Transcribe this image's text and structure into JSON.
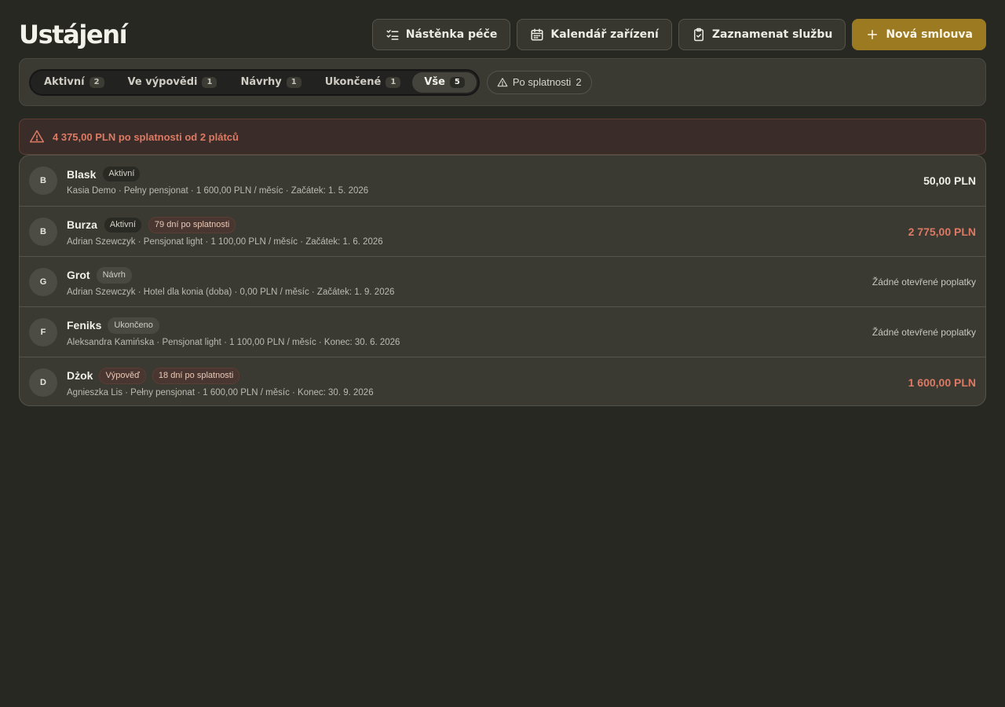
{
  "page": {
    "title": "Ustájení"
  },
  "header": {
    "buttons": [
      {
        "label": "Nástěnka péče",
        "icon": "checklist-icon"
      },
      {
        "label": "Kalendář zařízení",
        "icon": "calendar-icon"
      },
      {
        "label": "Zaznamenat službu",
        "icon": "clipboard-check-icon"
      },
      {
        "label": "Nová smlouva",
        "icon": "plus-icon"
      }
    ]
  },
  "filters": {
    "tabs": [
      {
        "label": "Aktivní",
        "count": "2"
      },
      {
        "label": "Ve výpovědi",
        "count": "1"
      },
      {
        "label": "Návrhy",
        "count": "1"
      },
      {
        "label": "Ukončené",
        "count": "1"
      },
      {
        "label": "Vše",
        "count": "5"
      }
    ],
    "overdue_chip": {
      "label": "Po splatnosti",
      "count": "2"
    }
  },
  "alert": {
    "text": "4 375,00 PLN po splatnosti od 2 plátců"
  },
  "contracts": [
    {
      "initial": "B",
      "name": "Blask",
      "status": "Aktivní",
      "overdue": "",
      "meta": "Kasia Demo · Pełny pensjonat · 1 600,00 PLN / měsíc · Začátek: 1. 5. 2026",
      "amount": "50,00 PLN"
    },
    {
      "initial": "B",
      "name": "Burza",
      "status": "Aktivní",
      "overdue": "79 dní po splatnosti",
      "meta": "Adrian Szewczyk · Pensjonat light · 1 100,00 PLN / měsíc · Začátek: 1. 6. 2026",
      "amount": "2 775,00 PLN"
    },
    {
      "initial": "G",
      "name": "Grot",
      "status": "Návrh",
      "overdue": "",
      "meta": "Adrian Szewczyk · Hotel dla konia (doba) · 0,00 PLN / měsíc · Začátek: 1. 9. 2026",
      "amount": "Žádné otevřené poplatky"
    },
    {
      "initial": "F",
      "name": "Feniks",
      "status": "Ukončeno",
      "overdue": "",
      "meta": "Aleksandra Kamińska · Pensjonat light · 1 100,00 PLN / měsíc · Konec: 30. 6. 2026",
      "amount": "Žádné otevřené poplatky"
    },
    {
      "initial": "D",
      "name": "Dżok",
      "status": "Výpověď",
      "overdue": "18 dní po splatnosti",
      "meta": "Agnieszka Lis · Pełny pensjonat · 1 600,00 PLN / měsíc · Konec: 30. 9. 2026",
      "amount": "1 600,00 PLN"
    }
  ],
  "colors": {
    "accent": "#9c7a22",
    "overdue": "#de7a63",
    "background": "#282823"
  }
}
